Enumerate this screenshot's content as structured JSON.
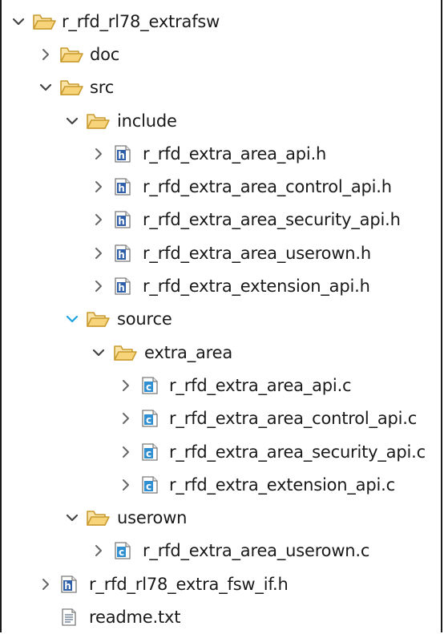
{
  "tree": {
    "root": {
      "label": "r_rfd_rl78_extrafsw"
    },
    "doc": {
      "label": "doc"
    },
    "src": {
      "label": "src"
    },
    "include": {
      "label": "include"
    },
    "include_files": [
      {
        "label": "r_rfd_extra_area_api.h"
      },
      {
        "label": "r_rfd_extra_area_control_api.h"
      },
      {
        "label": "r_rfd_extra_area_security_api.h"
      },
      {
        "label": "r_rfd_extra_area_userown.h"
      },
      {
        "label": "r_rfd_extra_extension_api.h"
      }
    ],
    "source": {
      "label": "source"
    },
    "extra_area": {
      "label": "extra_area"
    },
    "extra_area_files": [
      {
        "label": "r_rfd_extra_area_api.c"
      },
      {
        "label": "r_rfd_extra_area_control_api.c"
      },
      {
        "label": "r_rfd_extra_area_security_api.c"
      },
      {
        "label": "r_rfd_extra_extension_api.c"
      }
    ],
    "userown": {
      "label": "userown"
    },
    "userown_files": [
      {
        "label": "r_rfd_extra_area_userown.c"
      }
    ],
    "root_files": [
      {
        "label": "r_rfd_rl78_extra_fsw_if.h"
      },
      {
        "label": "readme.txt"
      }
    ]
  },
  "colors": {
    "folder_fill": "#f7d37a",
    "folder_stroke": "#c99a2e",
    "chevron": "#555555",
    "chevron_selected": "#1ba1e2",
    "h_badge": "#2f5fa8",
    "c_badge": "#2f8fd0"
  }
}
